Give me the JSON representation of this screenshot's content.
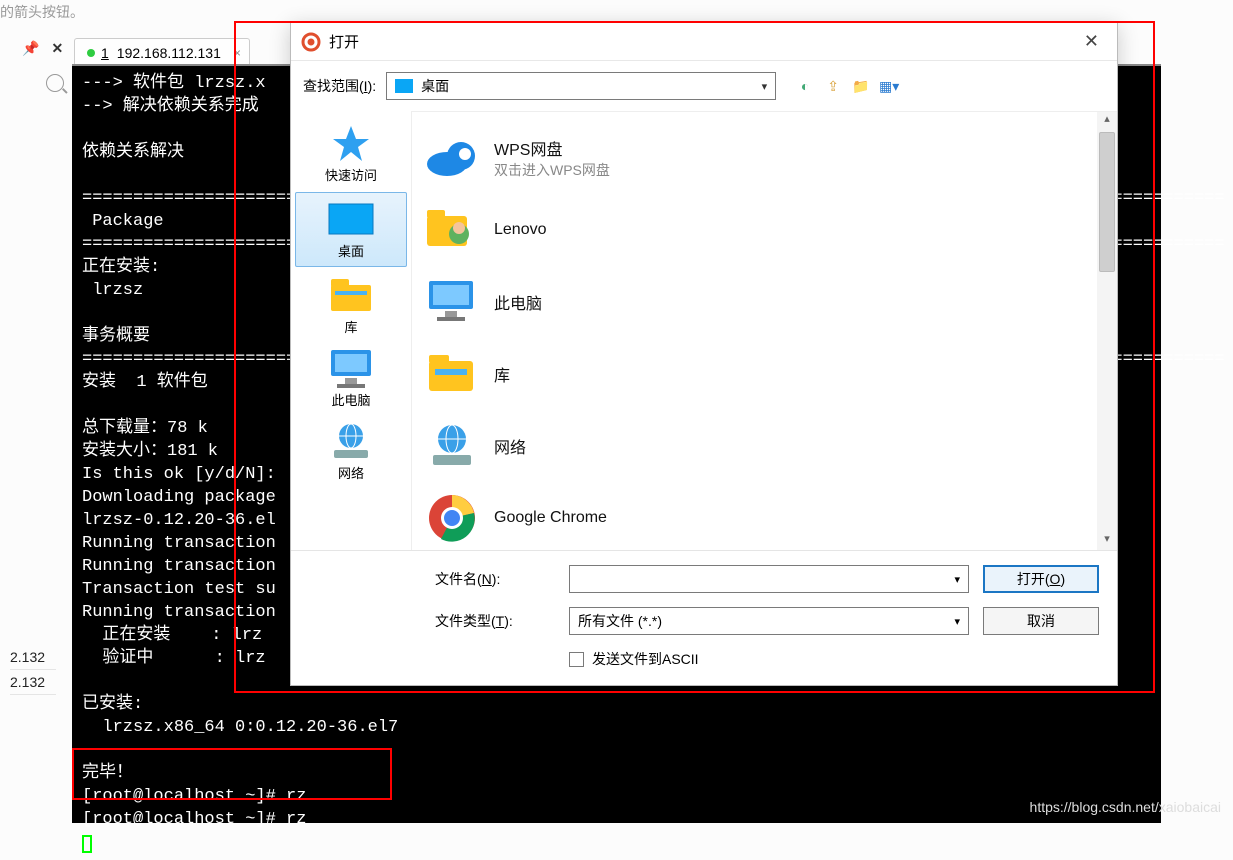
{
  "top_hint": "的箭头按钮。",
  "tab": {
    "number": "1",
    "ip": "192.168.112.131"
  },
  "left_list": [
    "2.132",
    "2.132"
  ],
  "terminal_lines": [
    "---> 软件包 lrzsz.x",
    "--> 解决依赖关系完成",
    "",
    "依赖关系解决",
    "",
    "================================================================================================================",
    " Package",
    "================================================================================================================",
    "正在安装:",
    " lrzsz",
    "",
    "事务概要",
    "================================================================================================================",
    "安装  1 软件包",
    "",
    "总下载量：78 k",
    "安装大小：181 k",
    "Is this ok [y/d/N]:",
    "Downloading package",
    "lrzsz-0.12.20-36.el",
    "Running transaction",
    "Running transaction",
    "Transaction test su",
    "Running transaction",
    "  正在安装    : lrz",
    "  验证中      : lrz",
    "",
    "已安装:",
    "  lrzsz.x86_64 0:0.12.20-36.el7",
    "",
    "完毕！",
    "[root@localhost ~]# rz",
    "[root@localhost ~]# rz"
  ],
  "dialog": {
    "title": "打开",
    "lookin_label_pre": "查找范围(",
    "lookin_label_u": "I",
    "lookin_label_post": "):",
    "lookin_value": "桌面",
    "sidebar": [
      {
        "label": "快速访问"
      },
      {
        "label": "桌面"
      },
      {
        "label": "库"
      },
      {
        "label": "此电脑"
      },
      {
        "label": "网络"
      }
    ],
    "files": [
      {
        "title": "WPS网盘",
        "sub": "双击进入WPS网盘"
      },
      {
        "title": "Lenovo",
        "sub": ""
      },
      {
        "title": "此电脑",
        "sub": ""
      },
      {
        "title": "库",
        "sub": ""
      },
      {
        "title": "网络",
        "sub": ""
      },
      {
        "title": "Google Chrome",
        "sub": ""
      }
    ],
    "filename_label_pre": "文件名(",
    "filename_label_u": "N",
    "filename_label_post": "):",
    "filename_value": "",
    "filetype_label_pre": "文件类型(",
    "filetype_label_u": "T",
    "filetype_label_post": "):",
    "filetype_value": "所有文件 (*.*)",
    "open_btn_pre": "打开(",
    "open_btn_u": "O",
    "open_btn_post": ")",
    "cancel_btn": "取消",
    "ascii_label": "发送文件到ASCII"
  },
  "watermark": "https://blog.csdn.net/xaiobaicai"
}
